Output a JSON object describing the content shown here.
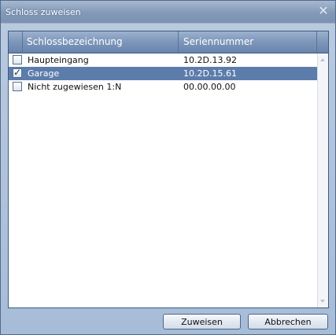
{
  "dialog": {
    "title": "Schloss zuweisen",
    "close_glyph": "✕"
  },
  "table": {
    "columns": [
      "Schlossbezeichnung",
      "Seriennummer"
    ],
    "rows": [
      {
        "checked": false,
        "selected": false,
        "name": "Haupteingang",
        "serial": "10.2D.13.92"
      },
      {
        "checked": true,
        "selected": true,
        "name": "Garage",
        "serial": "10.2D.15.61"
      },
      {
        "checked": false,
        "selected": false,
        "name": "Nicht zugewiesen 1:N",
        "serial": "00.00.00.00"
      }
    ]
  },
  "buttons": {
    "assign": "Zuweisen",
    "cancel": "Abbrechen"
  },
  "colors": {
    "selection": "#5c7cab",
    "header": "#7f98bb",
    "frame": "#8ea3c0"
  },
  "icons": {
    "close": "close-icon",
    "scroll_up": "scroll-up-icon",
    "scroll_down": "scroll-down-icon",
    "check": "checkmark-icon"
  }
}
